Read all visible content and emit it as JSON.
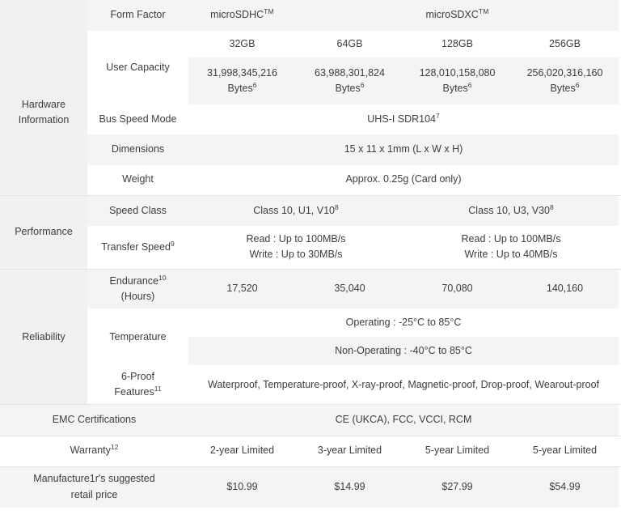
{
  "table": {
    "columns": [
      "32GB",
      "64GB",
      "128GB",
      "256GB"
    ],
    "form_factor": {
      "label": "Form Factor",
      "sdhc": "microSDHC",
      "sdhc_tm": "TM",
      "sdxc": "microSDXC",
      "sdxc_tm": "TM"
    },
    "groups": {
      "hardware": "Hardware\nInformation",
      "hardware_line1": "Hardware",
      "hardware_line2": "Information",
      "performance": "Performance",
      "reliability": "Reliability"
    },
    "rows": {
      "user_capacity": {
        "label": "User Capacity",
        "capacities": [
          "32GB",
          "64GB",
          "128GB",
          "256GB"
        ],
        "bytes": [
          "31,998,345,216",
          "63,988,301,824",
          "128,010,158,080",
          "256,020,316,160"
        ],
        "bytes_unit": "Bytes",
        "bytes_sup": "6"
      },
      "bus_speed": {
        "label": "Bus Speed Mode",
        "value": "UHS-I SDR104",
        "sup": "7"
      },
      "dimensions": {
        "label": "Dimensions",
        "value": "15 x 11 x 1mm (L x W x H)"
      },
      "weight": {
        "label": "Weight",
        "value": "Approx. 0.25g (Card only)"
      },
      "speed_class": {
        "label": "Speed Class",
        "value_left": "Class 10, U1, V10",
        "value_left_sup": "8",
        "value_right": "Class 10, U3, V30",
        "value_right_sup": "8"
      },
      "transfer_speed": {
        "label": "Transfer Speed",
        "label_sup": "9",
        "left_read": "Read : Up to 100MB/s",
        "left_write": "Write : Up to 30MB/s",
        "right_read": "Read : Up to 100MB/s",
        "right_write": "Write : Up to 40MB/s"
      },
      "endurance": {
        "label_line1": "Endurance",
        "label_sup": "10",
        "label_line2": "(Hours)",
        "values": [
          "17,520",
          "35,040",
          "70,080",
          "140,160"
        ]
      },
      "temperature": {
        "label": "Temperature",
        "operating": "Operating : -25°C to 85°C",
        "non_operating": "Non-Operating : -40°C to 85°C"
      },
      "six_proof": {
        "label_line1": "6-Proof",
        "label_line2": "Features",
        "label_sup": "11",
        "value": "Waterproof, Temperature-proof, X-ray-proof, Magnetic-proof, Drop-proof, Wearout-proof"
      },
      "emc": {
        "label": "EMC Certifications",
        "value": "CE (UKCA), FCC, VCCI, RCM"
      },
      "warranty": {
        "label": "Warranty",
        "label_sup": "12",
        "values": [
          "2-year Limited",
          "3-year Limited",
          "5-year Limited",
          "5-year Limited"
        ]
      },
      "msrp": {
        "label_line1": "Manufacture1r's suggested",
        "label_line2": "retail price",
        "values": [
          "$10.99",
          "$14.99",
          "$27.99",
          "$54.99"
        ]
      }
    }
  },
  "colors": {
    "page_bg": "#ffffff",
    "cell_gray": "#f4f4f4",
    "group_gray": "#f1f1f1",
    "text": "#3d3d3d",
    "divider": "#e4e4e4"
  }
}
